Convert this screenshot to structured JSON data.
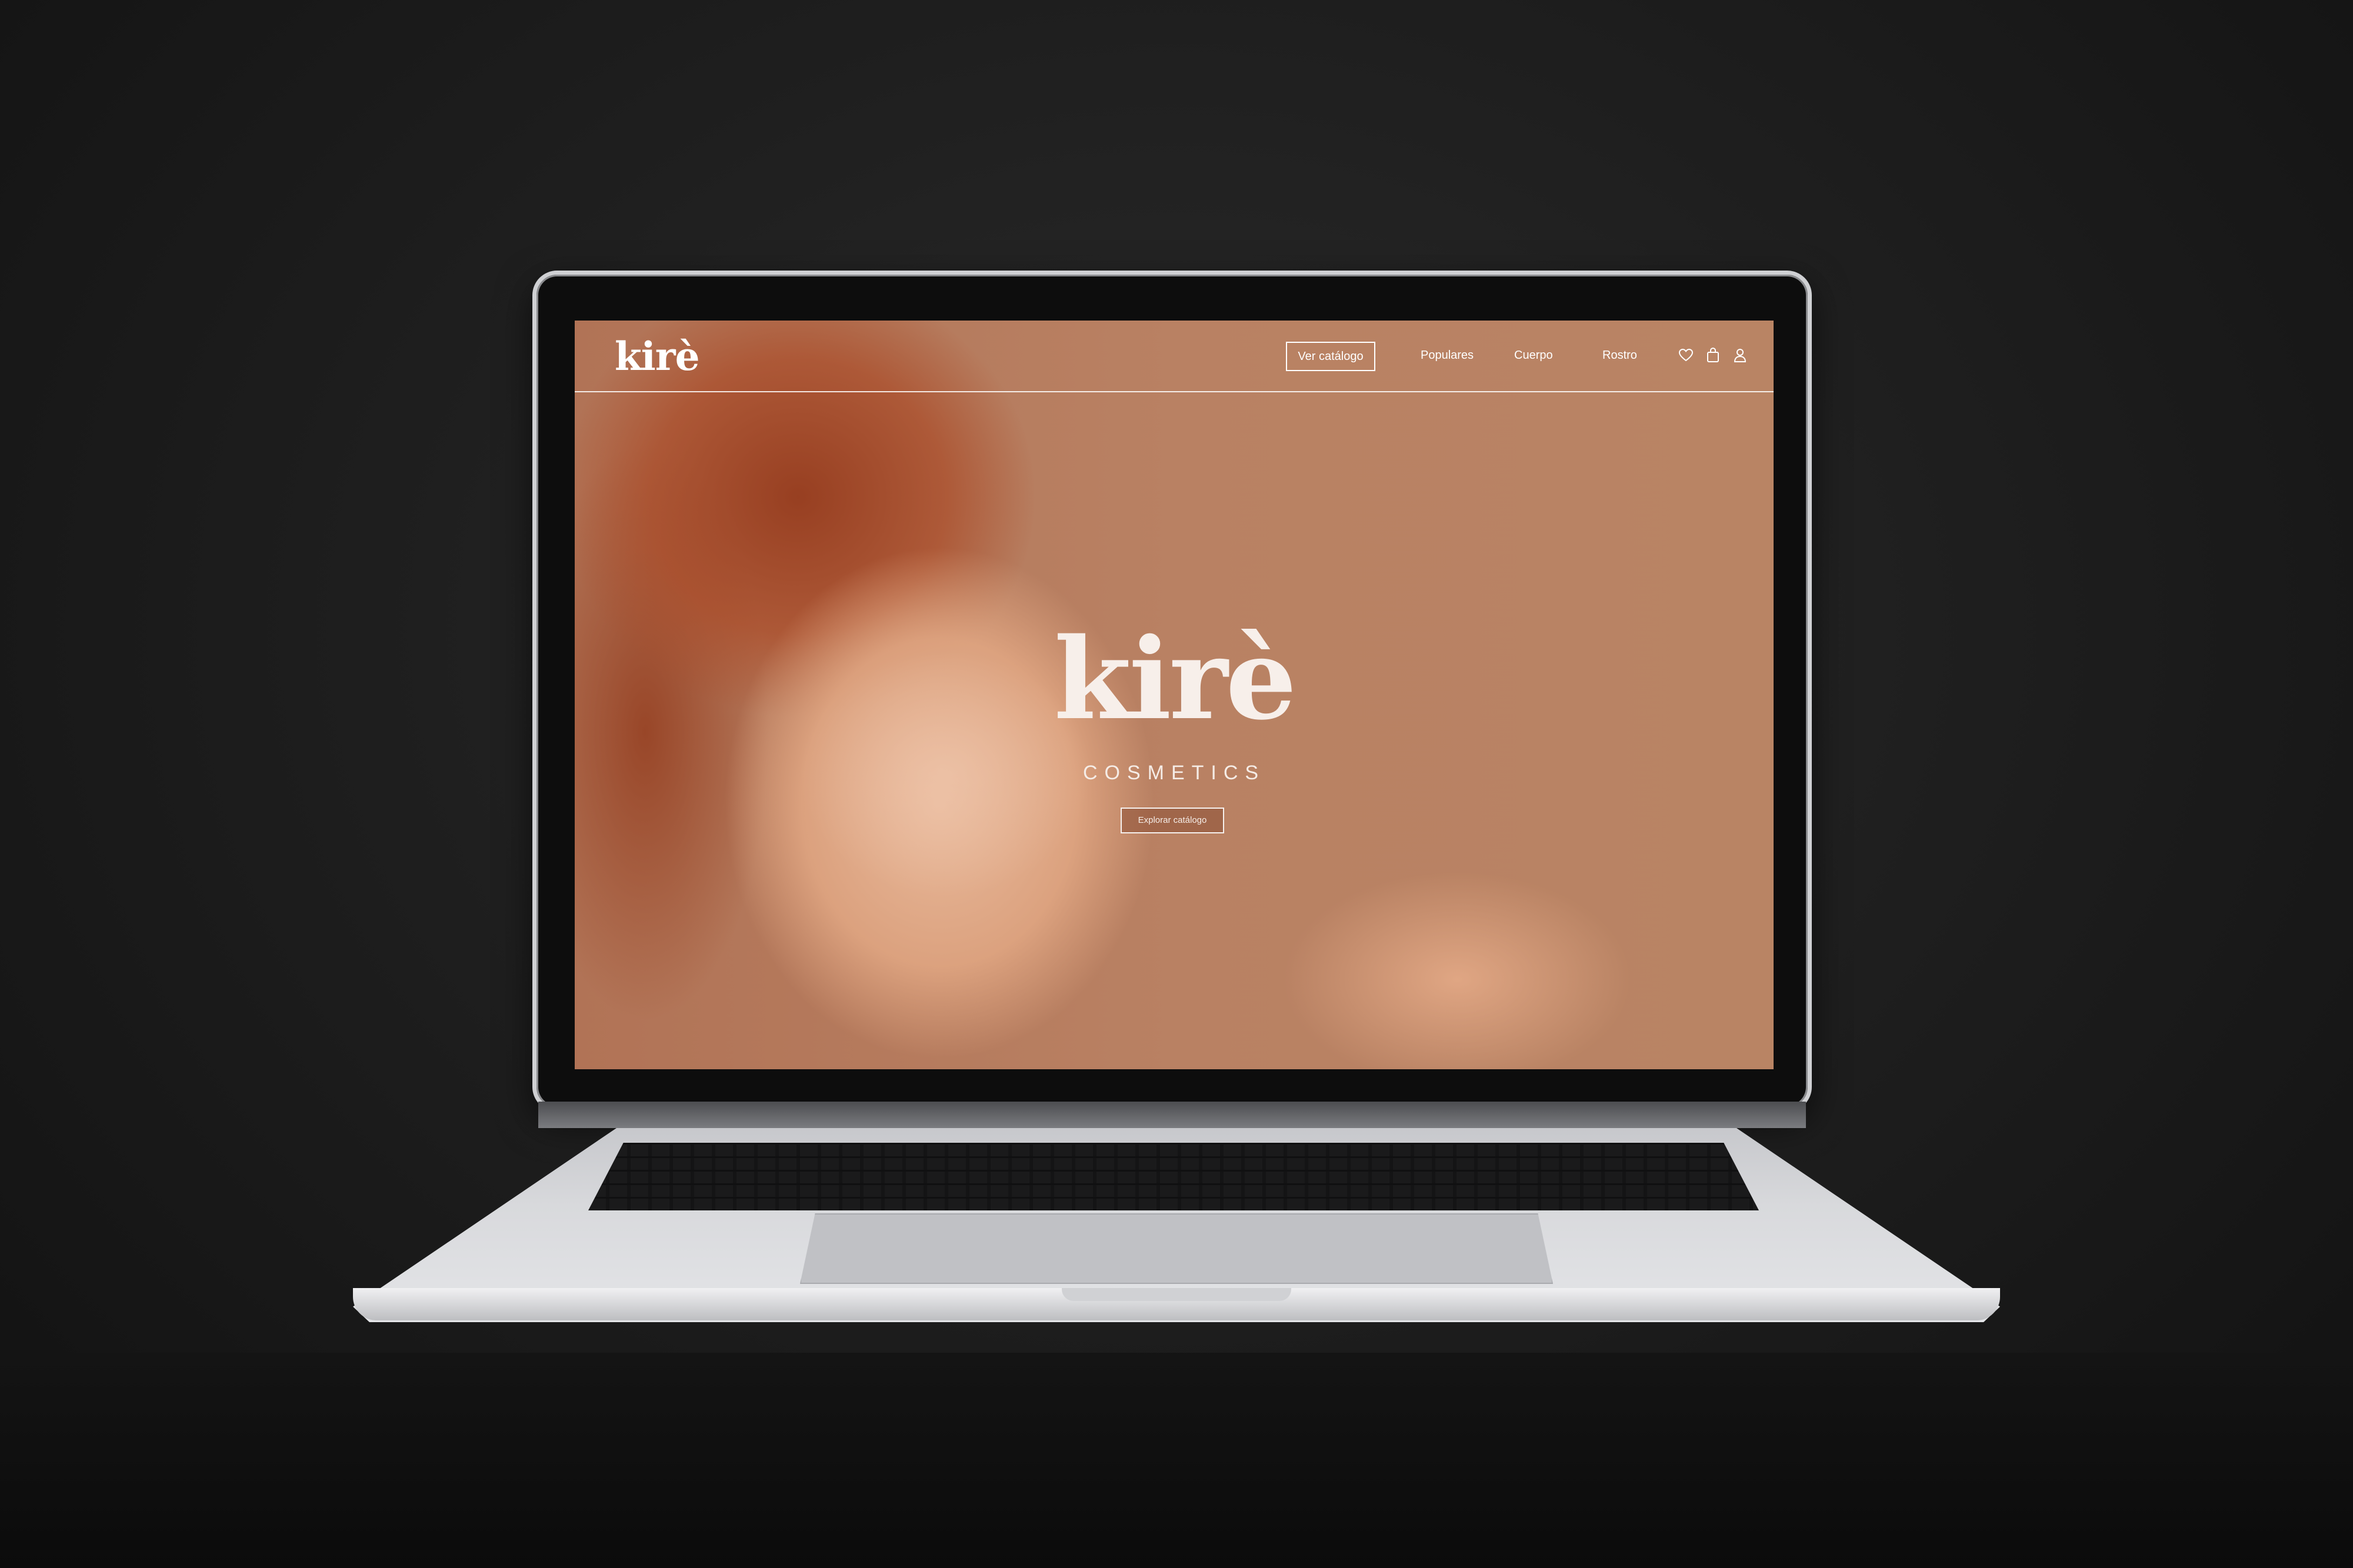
{
  "site": {
    "logo": "kirè",
    "nav": {
      "catalog_button": "Ver catálogo",
      "links": [
        "Populares",
        "Cuerpo",
        "Rostro"
      ],
      "icons": [
        "heart-icon",
        "shopping-bag-icon",
        "user-icon"
      ]
    },
    "hero": {
      "brand": "kirè",
      "subtitle": "COSMETICS",
      "cta": "Explorar catálogo"
    }
  },
  "colors": {
    "accent": "#b57f5f",
    "text_light": "#ffffff",
    "backdrop": "#1f1f1f"
  }
}
